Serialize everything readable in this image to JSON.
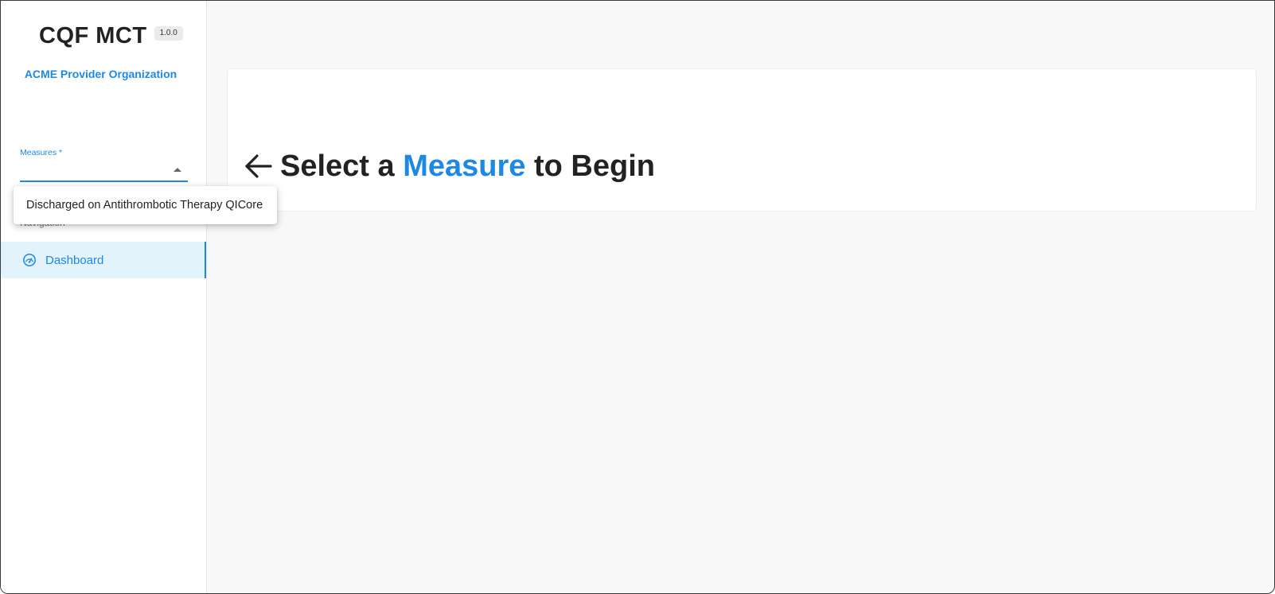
{
  "app": {
    "title": "CQF MCT",
    "version": "1.0.0",
    "organization": "ACME Provider Organization"
  },
  "measures": {
    "label": "Measures *",
    "selected_value": "",
    "options": [
      "Discharged on Antithrombotic Therapy QICore"
    ]
  },
  "navigation": {
    "header": "Navigation",
    "items": [
      {
        "label": "Dashboard",
        "icon": "dashboard-gauge-icon",
        "active": true
      }
    ]
  },
  "main": {
    "headline_prefix": "Select a ",
    "headline_accent": "Measure",
    "headline_suffix": " to Begin",
    "icon": "arrow-left-icon"
  },
  "colors": {
    "accent": "#1e88e5",
    "active_nav_bg": "#e3f3fc",
    "background": "#f8f8f8",
    "text": "#222222"
  }
}
